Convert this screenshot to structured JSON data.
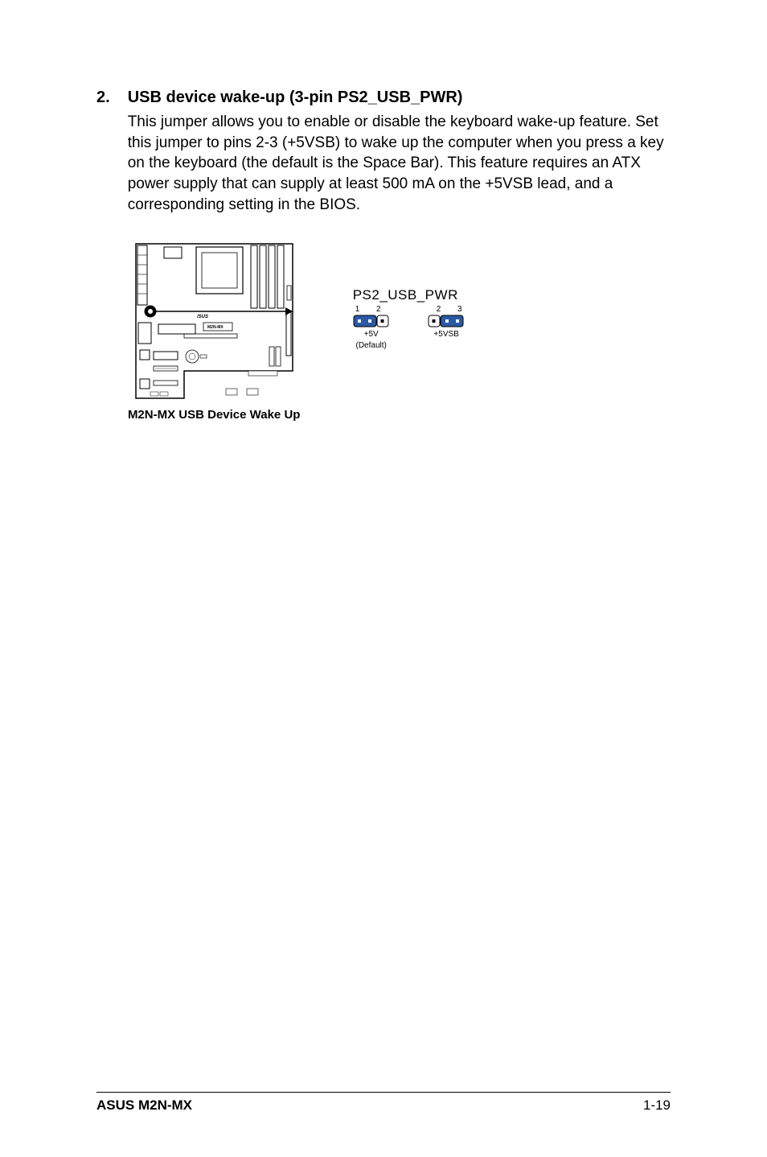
{
  "section": {
    "number": "2.",
    "title": "USB device wake-up (3-pin PS2_USB_PWR)",
    "paragraph": "This jumper allows you to enable or disable the keyboard wake-up feature. Set this jumper to pins 2-3 (+5VSB) to wake up the computer when you press a key on the keyboard (the default is the Space Bar). This feature requires an ATX power supply that can supply at least 500 mA on the +5VSB lead, and a corresponding setting in the BIOS."
  },
  "diagram": {
    "board_model_text": "M2N-MX",
    "caption": "M2N-MX USB Device Wake Up",
    "header_label": "PS2_USB_PWR",
    "options": [
      {
        "pin_numbers": "1 2",
        "voltage": "+5V",
        "note": "(Default)",
        "cap_side": "left"
      },
      {
        "pin_numbers": "2 3",
        "voltage": "+5VSB",
        "note": "",
        "cap_side": "right"
      }
    ]
  },
  "footer": {
    "left": "ASUS M2N-MX",
    "right": "1-19"
  }
}
